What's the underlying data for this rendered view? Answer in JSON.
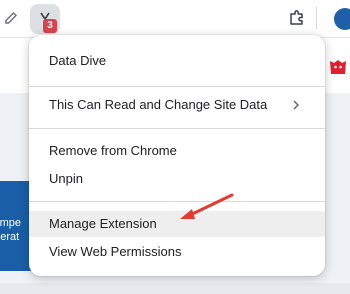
{
  "toolbar": {
    "extension_badge_count": "3",
    "icons": [
      "pencil-icon",
      "extension-logo-icon",
      "puzzle-icon",
      "profile-avatar"
    ]
  },
  "page": {
    "card_line1": "compe",
    "card_line2": "enerat"
  },
  "menu": {
    "items": [
      {
        "label": "Data Dive"
      },
      {
        "label": "This Can Read and Change Site Data",
        "icon": "chevron-right-icon"
      },
      {
        "label": "Remove from Chrome"
      },
      {
        "label": "Unpin"
      },
      {
        "label": "Manage Extension",
        "highlighted": true
      },
      {
        "label": "View Web Permissions"
      }
    ]
  },
  "colors": {
    "badge": "#d9434b",
    "annotation_arrow": "#e6392f",
    "highlight": "#eeeeee",
    "brand_red": "#e0202f"
  }
}
